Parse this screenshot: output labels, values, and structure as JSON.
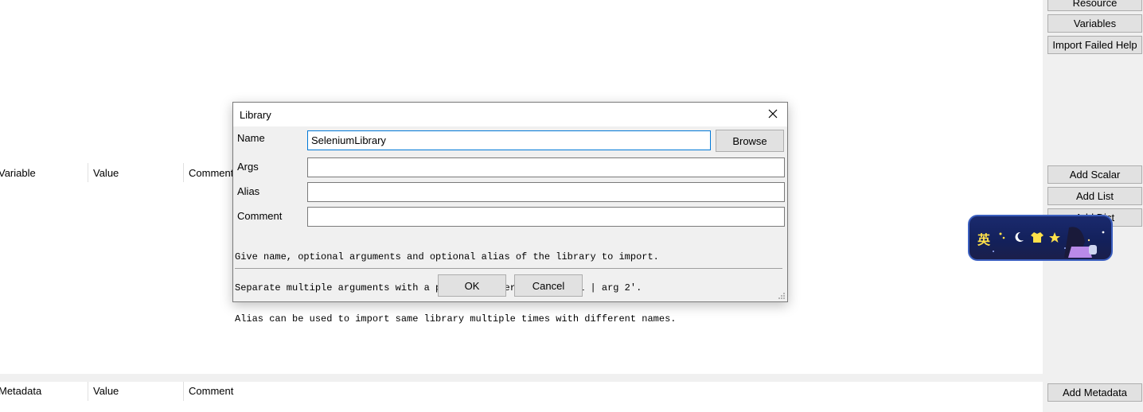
{
  "right_panel": {
    "buttons_top": [
      "Resource",
      "Variables",
      "Import Failed Help"
    ],
    "buttons_mid": [
      "Add Scalar",
      "Add List",
      "Add Dict"
    ],
    "buttons_bottom": [
      "Add Metadata"
    ]
  },
  "variables_table": {
    "headers": [
      "Variable",
      "Value",
      "Comment"
    ]
  },
  "metadata_table": {
    "headers": [
      "Metadata",
      "Value",
      "Comment"
    ]
  },
  "dialog": {
    "title": "Library",
    "close_icon": "close-icon",
    "name_label": "Name",
    "name_value": "SeleniumLibrary",
    "browse_label": "Browse",
    "args_label": "Args",
    "args_value": "",
    "alias_label": "Alias",
    "alias_value": "",
    "comment_label": "Comment",
    "comment_value": "",
    "help_lines": [
      "Give name, optional arguments and optional alias of the library to import.",
      "Separate multiple arguments with a pipe character like 'arg 1 | arg 2'.",
      "Alias can be used to import same library multiple times with different names."
    ],
    "ok_label": "OK",
    "cancel_label": "Cancel"
  },
  "ime": {
    "mode_char": "英",
    "icons": [
      "dots-icon",
      "moon-icon",
      "shirt-icon",
      "star-icon"
    ]
  },
  "colors": {
    "panel_bg": "#f0f0f0",
    "button_bg": "#e1e1e1",
    "focus_border": "#0078d7",
    "ime_bg": "#1a2a6e"
  }
}
